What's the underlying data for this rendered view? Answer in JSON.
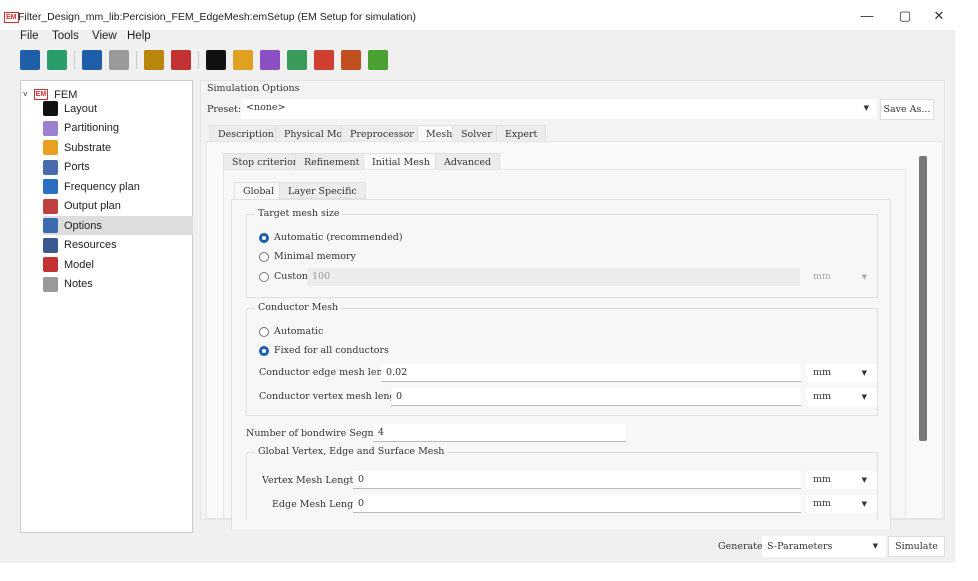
{
  "window": {
    "title": "Filter_Design_mm_lib:Percision_FEM_EdgeMesh:emSetup (EM Setup for simulation)",
    "logo": "EM",
    "minimize": "—",
    "restore": "▢",
    "close": "✕"
  },
  "menu": [
    "File",
    "Tools",
    "View",
    "Help"
  ],
  "toolbar": [
    {
      "icon": "save-icon",
      "color": "#1f5fa8"
    },
    {
      "icon": "em-import-icon",
      "color": "#2a9d6a"
    },
    {
      "icon": "undo-icon",
      "color": "#1f5fa8"
    },
    {
      "icon": "redo-icon",
      "color": "#999999"
    },
    {
      "icon": "em-simulate-icon",
      "color": "#b8860b"
    },
    {
      "icon": "em-stop-icon",
      "color": "#c33333"
    },
    {
      "icon": "layout-icon",
      "color": "#111111"
    },
    {
      "icon": "substrate-icon",
      "color": "#e0a020"
    },
    {
      "icon": "port-icon",
      "color": "#8a4fc0"
    },
    {
      "icon": "box-icon",
      "color": "#3a9a5a"
    },
    {
      "icon": "color-map-icon",
      "color": "#d04030"
    },
    {
      "icon": "component-icon",
      "color": "#c05020"
    },
    {
      "icon": "field-icon",
      "color": "#4aa030"
    }
  ],
  "tree": {
    "root": "FEM",
    "root_logo": "EM",
    "items": [
      {
        "label": "Layout",
        "icon": "layout-icon",
        "color": "#111111"
      },
      {
        "label": "Partitioning",
        "icon": "partitioning-icon",
        "color": "#9b7fd0"
      },
      {
        "label": "Substrate",
        "icon": "substrate-icon",
        "color": "#e8a020"
      },
      {
        "label": "Ports",
        "icon": "ports-icon",
        "color": "#4a6ab0"
      },
      {
        "label": "Frequency plan",
        "icon": "frequency-icon",
        "color": "#2a6fc0"
      },
      {
        "label": "Output plan",
        "icon": "output-plan-icon",
        "color": "#c04040"
      },
      {
        "label": "Options",
        "icon": "options-icon",
        "color": "#3a6ab0",
        "selected": true
      },
      {
        "label": "Resources",
        "icon": "resources-icon",
        "color": "#3a5a90"
      },
      {
        "label": "Model",
        "icon": "model-icon",
        "color": "#c33333"
      },
      {
        "label": "Notes",
        "icon": "notes-icon",
        "color": "#999999"
      }
    ]
  },
  "options": {
    "header": "Simulation Options",
    "preset_label": "Preset:",
    "preset_value": "<none>",
    "save_as": "Save As...",
    "tabs": [
      "Description",
      "Physical Model",
      "Preprocessor",
      "Mesh",
      "Solver",
      "Expert"
    ],
    "subtabs": [
      "Stop criterion",
      "Refinement",
      "Initial Mesh",
      "Advanced"
    ],
    "subsubtabs": [
      "Global",
      "Layer Specific"
    ],
    "target": {
      "title": "Target mesh size",
      "automatic": "Automatic (recommended)",
      "minimal": "Minimal memory",
      "custom": "Custom",
      "custom_value": "100",
      "unit": "mm"
    },
    "conductor": {
      "title": "Conductor Mesh",
      "automatic": "Automatic",
      "fixed": "Fixed for all conductors",
      "edge_label": "Conductor edge mesh length:",
      "edge_value": "0.02",
      "edge_unit": "mm",
      "vertex_label": "Conductor vertex mesh length:",
      "vertex_value": "0",
      "vertex_unit": "mm"
    },
    "bondwire_label": "Number of bondwire Segments:",
    "bondwire_value": "4",
    "global": {
      "title": "Global Vertex, Edge and Surface Mesh",
      "vertex_label": "Vertex Mesh Length:",
      "vertex_value": "0",
      "vertex_unit": "mm",
      "edge_label": "Edge Mesh Length:",
      "edge_value": "0",
      "edge_unit": "mm"
    }
  },
  "footer": {
    "generate_label": "Generate:",
    "generate_value": "S-Parameters",
    "simulate": "Simulate"
  }
}
